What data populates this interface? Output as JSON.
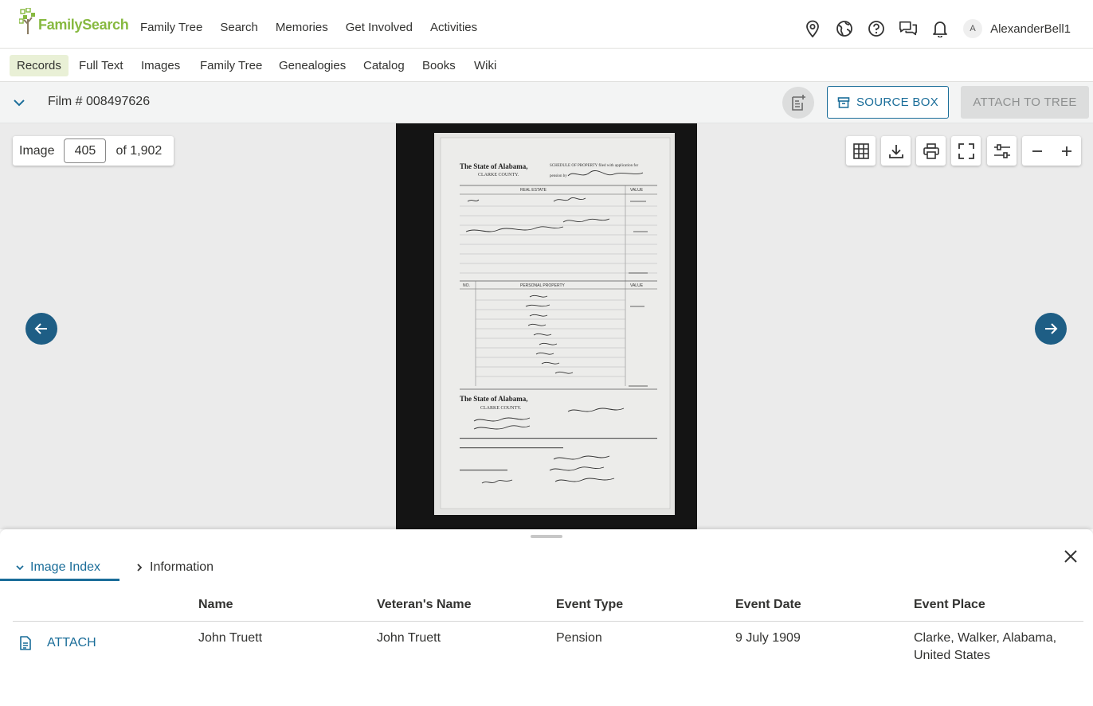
{
  "brand": {
    "name": "FamilySearch",
    "color": "#87b940"
  },
  "header": {
    "nav": [
      "Family Tree",
      "Search",
      "Memories",
      "Get Involved",
      "Activities"
    ],
    "icons": [
      "map-pin-icon",
      "globe-icon",
      "help-icon",
      "chat-icon",
      "bell-icon"
    ],
    "avatar_initial": "A",
    "username": "AlexanderBell1"
  },
  "subnav": {
    "items": [
      "Records",
      "Full Text",
      "Images",
      "Family Tree",
      "Genealogies",
      "Catalog",
      "Books",
      "Wiki"
    ],
    "active": "Records"
  },
  "filmbar": {
    "title": "Film # 008497626",
    "source_box_label": "SOURCE BOX",
    "attach_tree_label": "ATTACH TO TREE"
  },
  "viewer": {
    "image_label": "Image",
    "image_number": "405",
    "image_total_label": "of 1,902",
    "tools": [
      "grid-icon",
      "download-icon",
      "print-icon",
      "fullscreen-icon",
      "adjust-icon",
      "zoom-out-icon",
      "zoom-in-icon"
    ]
  },
  "panel": {
    "tabs": [
      {
        "label": "Image Index",
        "active": true
      },
      {
        "label": "Information",
        "active": false
      }
    ],
    "columns": [
      "Name",
      "Veteran's Name",
      "Event Type",
      "Event Date",
      "Event Place"
    ],
    "rows": [
      {
        "action": "ATTACH",
        "name": "John Truett",
        "veteran_name": "John Truett",
        "event_type": "Pension",
        "event_date": "9 July 1909",
        "event_place_line1": "Clarke, Walker, Alabama,",
        "event_place_line2": "United States"
      }
    ]
  },
  "colors": {
    "accent": "#1a6d99",
    "nav_arrow": "#1e5e85",
    "active_subnav": "#e9f0d6"
  }
}
